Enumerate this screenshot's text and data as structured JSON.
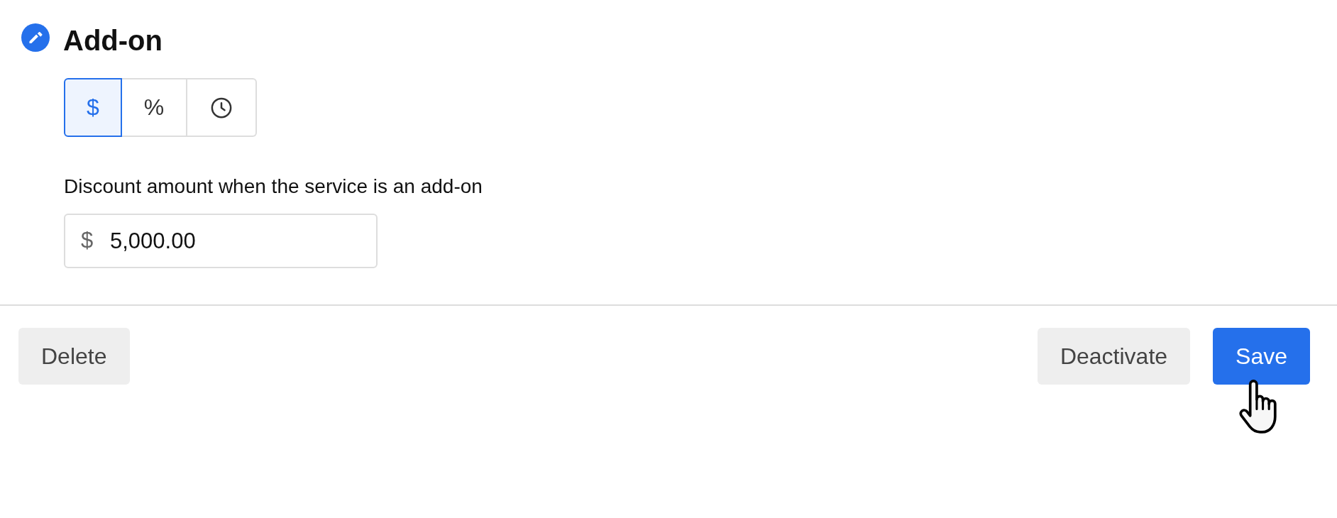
{
  "header": {
    "title": "Add-on"
  },
  "discount_type": [
    {
      "kind": "text",
      "label": "$",
      "selected": true
    },
    {
      "kind": "text",
      "label": "%",
      "selected": false
    },
    {
      "kind": "clock",
      "selected": false
    }
  ],
  "discount_field": {
    "label": "Discount amount when the service is an add-on",
    "prefix": "$",
    "value": "5,000.00"
  },
  "footer": {
    "left_actions": [
      {
        "label": "Delete",
        "kind": "secondary"
      }
    ],
    "right_actions": [
      {
        "label": "Deactivate",
        "kind": "secondary"
      },
      {
        "label": "Save",
        "kind": "primary"
      }
    ]
  }
}
